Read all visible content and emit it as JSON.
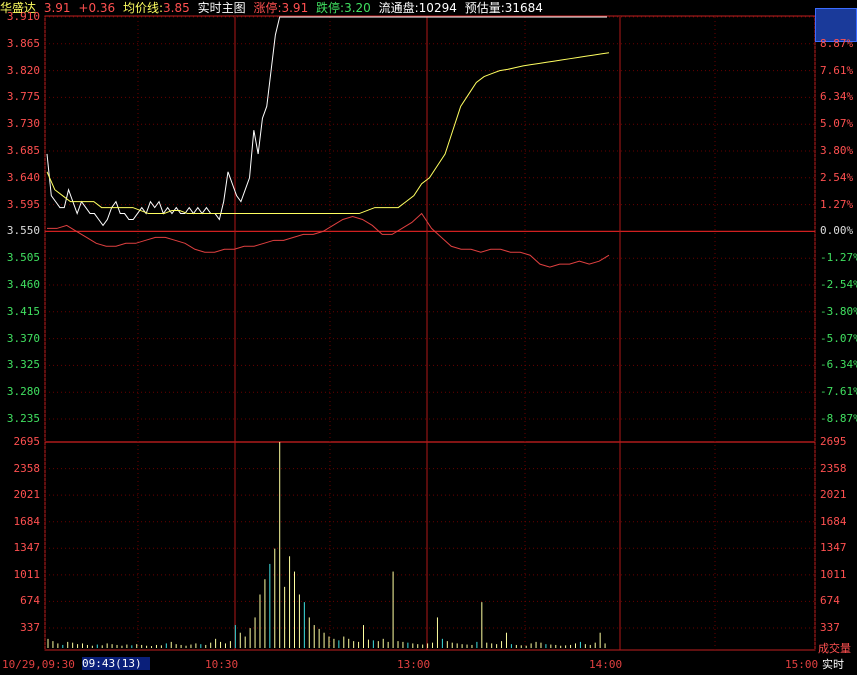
{
  "header": {
    "stock_name": "华盛达",
    "price": "3.91",
    "change": "+0.36",
    "avg_label": "均价线:",
    "avg_value": "3.85",
    "mode_label": "实时主图",
    "limit_up_label": "涨停:",
    "limit_up_value": "3.91",
    "limit_down_label": "跌停:",
    "limit_down_value": "3.20",
    "float_label": "流通盘:",
    "float_value": "10294",
    "est_vol_label": "预估量:",
    "est_vol_value": "31684"
  },
  "price_axis": {
    "left": [
      "3.910",
      "3.865",
      "3.820",
      "3.775",
      "3.730",
      "3.685",
      "3.640",
      "3.595",
      "3.550",
      "3.505",
      "3.460",
      "3.415",
      "3.370",
      "3.325",
      "3.280",
      "3.235"
    ],
    "right": [
      "",
      "8.87%",
      "7.61%",
      "6.34%",
      "5.07%",
      "3.80%",
      "2.54%",
      "1.27%",
      "0.00%",
      "-1.27%",
      "-2.54%",
      "-3.80%",
      "-5.07%",
      "-6.34%",
      "-7.61%",
      "-8.87%"
    ]
  },
  "volume_axis": {
    "left": [
      "2695",
      "2358",
      "2021",
      "1684",
      "1347",
      "1011",
      "674",
      "337"
    ],
    "right": [
      "2695",
      "2358",
      "2021",
      "1684",
      "1347",
      "1011",
      "674",
      "337"
    ],
    "label": "成交量"
  },
  "time_axis": {
    "start": "10/29,09:30",
    "cursor": "09:43(13)",
    "ticks": [
      "10:30",
      "13:00",
      "14:00",
      "15:00"
    ],
    "mode": "实时"
  },
  "chart_data": {
    "type": "line",
    "title": "",
    "prev_close": 3.55,
    "ylim": [
      3.19,
      3.91
    ],
    "series": [
      {
        "name": "",
        "color": "#ffffff",
        "values": [
          3.68,
          3.61,
          3.6,
          3.59,
          3.59,
          3.62,
          3.6,
          3.58,
          3.6,
          3.59,
          3.58,
          3.58,
          3.57,
          3.56,
          3.57,
          3.59,
          3.6,
          3.58,
          3.58,
          3.57,
          3.57,
          3.58,
          3.59,
          3.58,
          3.6,
          3.59,
          3.6,
          3.58,
          3.59,
          3.58,
          3.59,
          3.58,
          3.58,
          3.59,
          3.58,
          3.59,
          3.58,
          3.59,
          3.58,
          3.58,
          3.57,
          3.6,
          3.65,
          3.63,
          3.61,
          3.6,
          3.62,
          3.64,
          3.72,
          3.68,
          3.74,
          3.76,
          3.82,
          3.88,
          3.91,
          3.91
        ]
      },
      {
        "name": "均价线",
        "color": "#ffff60",
        "values": [
          3.65,
          3.62,
          3.61,
          3.6,
          3.6,
          3.6,
          3.6,
          3.59,
          3.59,
          3.59,
          3.59,
          3.59,
          3.585,
          3.58,
          3.58,
          3.58,
          3.585,
          3.585,
          3.58,
          3.58,
          3.58,
          3.58,
          3.58,
          3.58,
          3.58,
          3.58,
          3.58,
          3.58,
          3.58,
          3.58,
          3.58,
          3.58,
          3.58,
          3.58,
          3.58,
          3.58,
          3.58,
          3.58,
          3.58,
          3.58,
          3.58,
          3.585,
          3.59,
          3.59,
          3.59,
          3.59,
          3.6,
          3.61,
          3.63,
          3.64,
          3.66,
          3.68,
          3.72,
          3.76,
          3.78,
          3.8,
          3.81,
          3.815,
          3.82,
          3.822,
          3.825,
          3.828,
          3.83,
          3.832,
          3.834,
          3.836,
          3.838,
          3.84,
          3.842,
          3.844,
          3.846,
          3.848,
          3.85
        ]
      },
      {
        "name": "",
        "color": "#e04040",
        "values": [
          3.555,
          3.555,
          3.56,
          3.55,
          3.54,
          3.53,
          3.525,
          3.525,
          3.53,
          3.53,
          3.535,
          3.54,
          3.54,
          3.535,
          3.53,
          3.52,
          3.515,
          3.515,
          3.52,
          3.52,
          3.525,
          3.525,
          3.53,
          3.535,
          3.535,
          3.54,
          3.545,
          3.545,
          3.55,
          3.56,
          3.57,
          3.575,
          3.57,
          3.56,
          3.545,
          3.545,
          3.555,
          3.565,
          3.58,
          3.555,
          3.54,
          3.525,
          3.52,
          3.52,
          3.515,
          3.52,
          3.52,
          3.515,
          3.515,
          3.51,
          3.495,
          3.49,
          3.495,
          3.495,
          3.5,
          3.495,
          3.5,
          3.51
        ]
      }
    ],
    "volume": {
      "ylim": [
        0,
        2695
      ],
      "bars": [
        120,
        90,
        60,
        40,
        80,
        70,
        50,
        60,
        40,
        30,
        45,
        35,
        60,
        50,
        40,
        30,
        45,
        35,
        50,
        40,
        30,
        25,
        40,
        35,
        60,
        80,
        50,
        40,
        30,
        45,
        60,
        50,
        40,
        70,
        120,
        80,
        60,
        90,
        300,
        200,
        150,
        260,
        400,
        700,
        900,
        1100,
        1300,
        2700,
        800,
        1200,
        1000,
        700,
        600,
        400,
        300,
        250,
        200,
        150,
        120,
        100,
        150,
        120,
        90,
        80,
        300,
        110,
        100,
        90,
        120,
        80,
        1000,
        90,
        80,
        70,
        60,
        50,
        45,
        60,
        70,
        400,
        120,
        90,
        70,
        60,
        50,
        45,
        40,
        80,
        600,
        70,
        60,
        50,
        90,
        200,
        50,
        40,
        35,
        30,
        60,
        80,
        70,
        50,
        45,
        40,
        30,
        35,
        40,
        60,
        80,
        50,
        40,
        70,
        200,
        60
      ]
    }
  }
}
